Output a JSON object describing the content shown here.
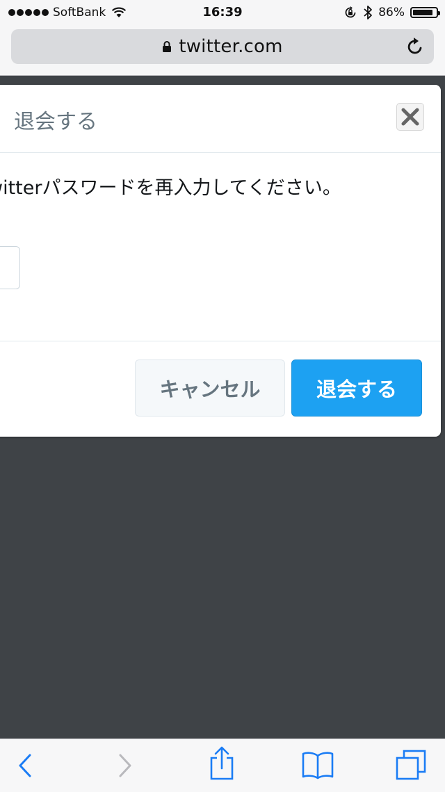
{
  "status_bar": {
    "carrier": "SoftBank",
    "time": "16:39",
    "battery_percent": "86%",
    "battery_level": 0.86
  },
  "browser": {
    "url": "twitter.com"
  },
  "dialog": {
    "title": "退会する",
    "prompt": "witterパスワードを再入力してください。",
    "cancel_label": "キャンセル",
    "confirm_label": "退会する"
  },
  "colors": {
    "accent": "#1da1f2",
    "overlay": "#3f4347",
    "ios_blue": "#1a7cf5"
  },
  "toolbar": {
    "icons": [
      "back-icon",
      "forward-icon",
      "share-icon",
      "bookmarks-icon",
      "tabs-icon"
    ]
  }
}
